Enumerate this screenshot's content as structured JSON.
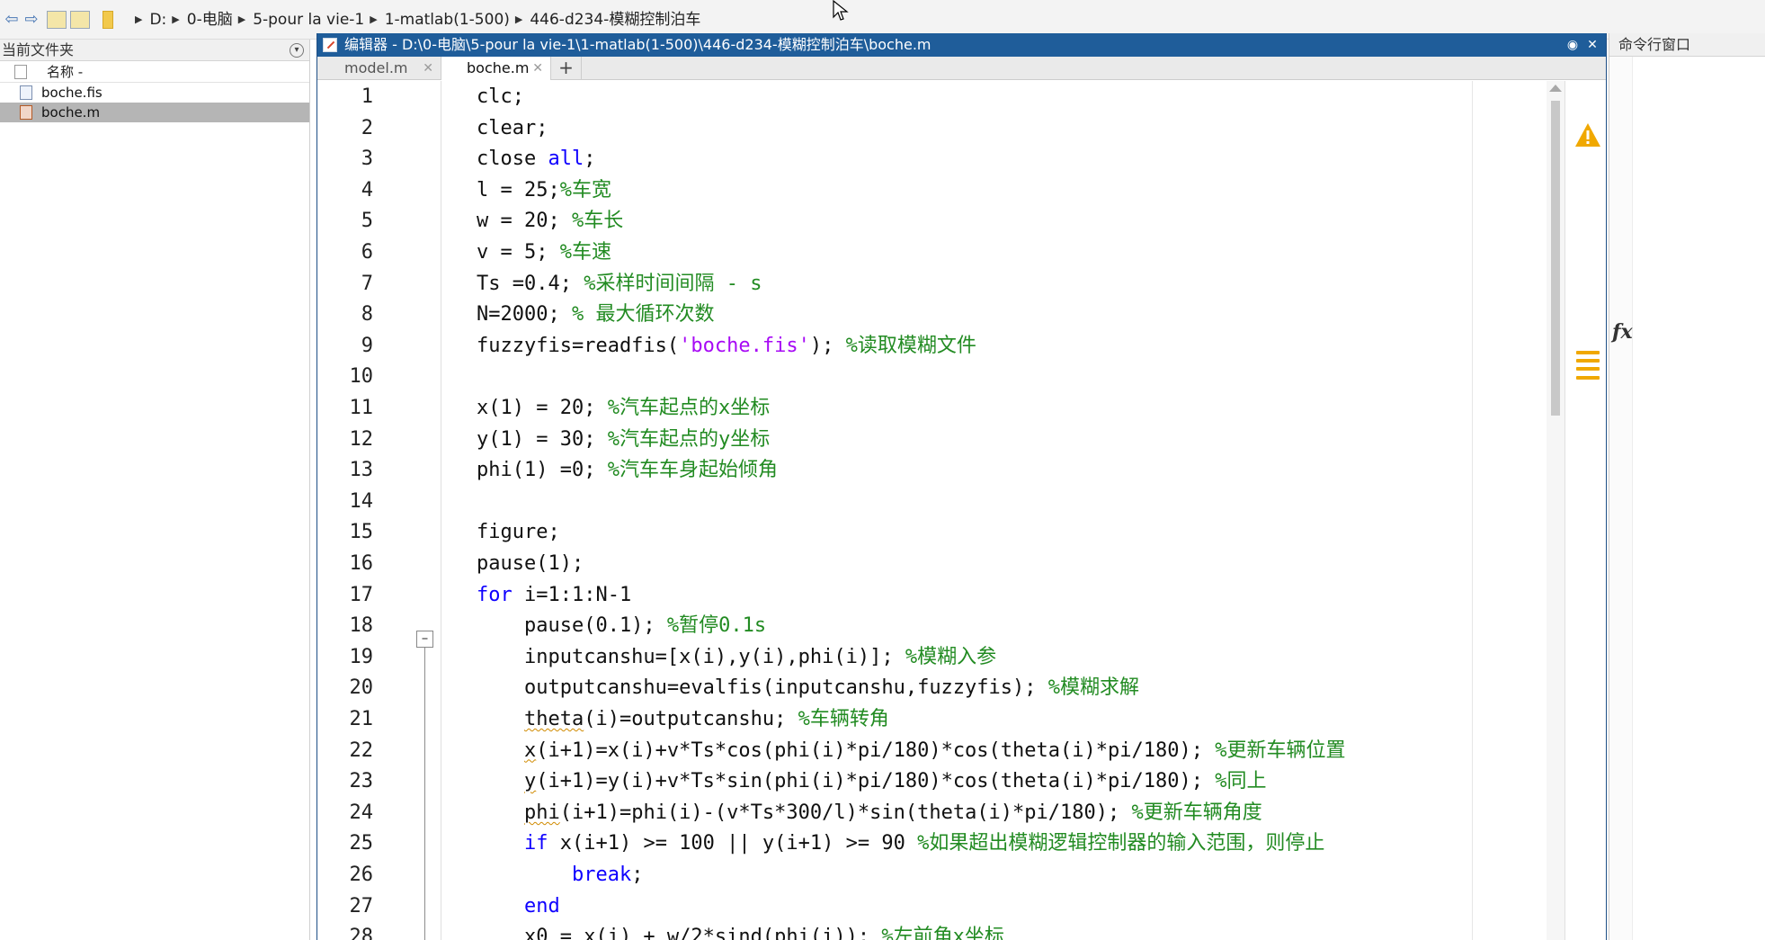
{
  "address_bar": {
    "back_icon": "back-arrow-icon",
    "forward_icon": "forward-arrow-icon",
    "breadcrumbs": [
      "D:",
      "0-电脑",
      "5-pour la vie-1",
      "1-matlab(1-500)",
      "446-d234-模糊控制泊车"
    ]
  },
  "current_folder": {
    "title": "当前文件夹",
    "column_header": "名称 -",
    "files": [
      {
        "name": "boche.fis",
        "selected": false
      },
      {
        "name": "boche.m",
        "selected": true
      }
    ]
  },
  "editor": {
    "title": "编辑器 - D:\\0-电脑\\5-pour la vie-1\\1-matlab(1-500)\\446-d234-模糊控制泊车\\boche.m",
    "tabs": [
      {
        "label": "model.m",
        "active": false
      },
      {
        "label": "boche.m",
        "active": true
      }
    ],
    "add_tab": "+",
    "line_numbers": [
      "1",
      "2",
      "3",
      "4",
      "5",
      "6",
      "7",
      "8",
      "9",
      "10",
      "11",
      "12",
      "13",
      "14",
      "15",
      "16",
      "17",
      "18",
      "19",
      "20",
      "21",
      "22",
      "23",
      "24",
      "25",
      "26",
      "27",
      "28"
    ],
    "fold_marker_line": 17,
    "code": [
      [
        [
          "n",
          "clc;"
        ]
      ],
      [
        [
          "n",
          "clear;"
        ]
      ],
      [
        [
          "n",
          "close "
        ],
        [
          "k",
          "all"
        ],
        [
          "n",
          ";"
        ]
      ],
      [
        [
          "n",
          "l = 25;"
        ],
        [
          "c",
          "%车宽"
        ]
      ],
      [
        [
          "n",
          "w = 20; "
        ],
        [
          "c",
          "%车长"
        ]
      ],
      [
        [
          "n",
          "v = 5; "
        ],
        [
          "c",
          "%车速"
        ]
      ],
      [
        [
          "n",
          "Ts =0.4; "
        ],
        [
          "c",
          "%采样时间间隔 - s"
        ]
      ],
      [
        [
          "n",
          "N=2000; "
        ],
        [
          "c",
          "% 最大循环次数"
        ]
      ],
      [
        [
          "n",
          "fuzzyfis=readfis("
        ],
        [
          "s",
          "'boche.fis'"
        ],
        [
          "n",
          "); "
        ],
        [
          "c",
          "%读取模糊文件"
        ]
      ],
      [],
      [
        [
          "n",
          "x(1) = 20; "
        ],
        [
          "c",
          "%汽车起点的x坐标"
        ]
      ],
      [
        [
          "n",
          "y(1) = 30; "
        ],
        [
          "c",
          "%汽车起点的y坐标"
        ]
      ],
      [
        [
          "n",
          "phi(1) =0; "
        ],
        [
          "c",
          "%汽车车身起始倾角"
        ]
      ],
      [],
      [
        [
          "n",
          "figure;"
        ]
      ],
      [
        [
          "n",
          "pause(1);"
        ]
      ],
      [
        [
          "k",
          "for"
        ],
        [
          "n",
          " i=1:1:N-1"
        ]
      ],
      [
        [
          "n",
          "    pause(0.1); "
        ],
        [
          "c",
          "%暂停0.1s"
        ]
      ],
      [
        [
          "n",
          "    inputcanshu=[x(i),y(i),phi(i)]; "
        ],
        [
          "c",
          "%模糊入参"
        ]
      ],
      [
        [
          "n",
          "    outputcanshu=evalfis(inputcanshu,fuzzyfis); "
        ],
        [
          "c",
          "%模糊求解"
        ]
      ],
      [
        [
          "n",
          "    "
        ],
        [
          "w",
          "theta"
        ],
        [
          "n",
          "(i)=outputcanshu; "
        ],
        [
          "c",
          "%车辆转角"
        ]
      ],
      [
        [
          "n",
          "    "
        ],
        [
          "w",
          "x"
        ],
        [
          "n",
          "(i+1)=x(i)+v*Ts*cos(phi(i)*pi/180)*cos(theta(i)*pi/180); "
        ],
        [
          "c",
          "%更新车辆位置"
        ]
      ],
      [
        [
          "n",
          "    "
        ],
        [
          "w",
          "y"
        ],
        [
          "n",
          "(i+1)=y(i)+v*Ts*sin(phi(i)*pi/180)*cos(theta(i)*pi/180); "
        ],
        [
          "c",
          "%同上"
        ]
      ],
      [
        [
          "n",
          "    "
        ],
        [
          "w",
          "phi"
        ],
        [
          "n",
          "(i+1)=phi(i)-(v*Ts*300/l)*sin(theta(i)*pi/180); "
        ],
        [
          "c",
          "%更新车辆角度"
        ]
      ],
      [
        [
          "n",
          "    "
        ],
        [
          "k",
          "if"
        ],
        [
          "n",
          " x(i+1) >= 100 || y(i+1) >= 90 "
        ],
        [
          "c",
          "%如果超出模糊逻辑控制器的输入范围，则停止"
        ]
      ],
      [
        [
          "n",
          "        "
        ],
        [
          "k",
          "break"
        ],
        [
          "n",
          ";"
        ]
      ],
      [
        [
          "n",
          "    "
        ],
        [
          "k",
          "end"
        ]
      ],
      [
        [
          "n",
          "    x0 = x(i) + w/2*sind(phi(i)); "
        ],
        [
          "c",
          "%左前角x坐标"
        ]
      ]
    ],
    "analyzer_icon": "warning-icon",
    "colors": {
      "keyword": "#0e00ff",
      "string": "#a709f5",
      "comment": "#228b22",
      "titlebar": "#1f5d9a"
    }
  },
  "command_window": {
    "title": "命令行窗口",
    "prompt_icon": "fx-icon",
    "prompt_text": "fx"
  }
}
